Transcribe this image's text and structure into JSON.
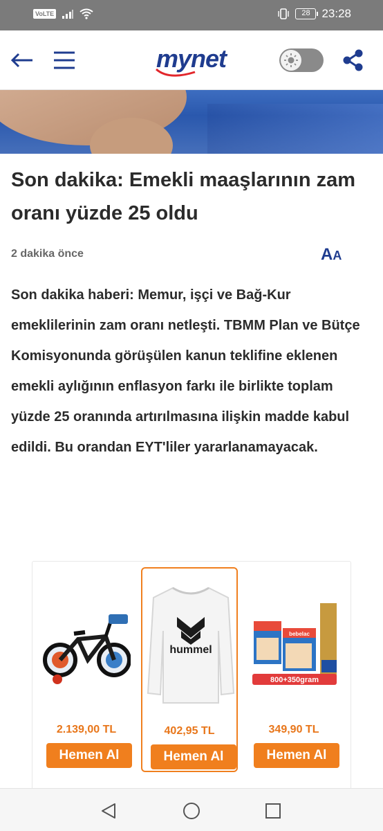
{
  "status_bar": {
    "volte": "VoLTE",
    "battery": "28",
    "time": "23:28"
  },
  "header": {
    "logo_text": "mynet",
    "icons": [
      "back-arrow-icon",
      "hamburger-menu-icon",
      "sun-icon",
      "share-icon"
    ],
    "theme_mode": "light",
    "accent_color": "#1f3c8f"
  },
  "article": {
    "title": "Son dakika: Emekli maaşlarının zam oranı yüzde 25 oldu",
    "time_ago": "2 dakika önce",
    "font_size_label_big": "A",
    "font_size_label_small": "A",
    "body": "Son dakika haberi: Memur, işçi ve Bağ-Kur emeklilerinin zam oranı netleşti. TBMM Plan ve Bütçe Komisyonunda görüşülen kanun teklifine eklenen emekli aylığının enflasyon farkı ile birlikte toplam yüzde 25 oranında artırılmasına ilişkin madde kabul edildi. Bu orandan EYT'liler yararlanamayacak."
  },
  "ads": {
    "accent_color": "#f07f1e",
    "products": [
      {
        "price": "2.139,00 TL",
        "button": "Hemen Al",
        "image": "bicycle"
      },
      {
        "price": "402,95 TL",
        "button": "Hemen Al",
        "image": "sweatshirt",
        "brand_print": "hummel"
      },
      {
        "price": "349,90 TL",
        "button": "Hemen Al",
        "image": "diaper-packs",
        "brand_print": "bebelac",
        "badge": "800+350gram"
      }
    ]
  },
  "nav": {
    "icons": [
      "back-triangle-icon",
      "home-circle-icon",
      "recents-square-icon"
    ]
  }
}
